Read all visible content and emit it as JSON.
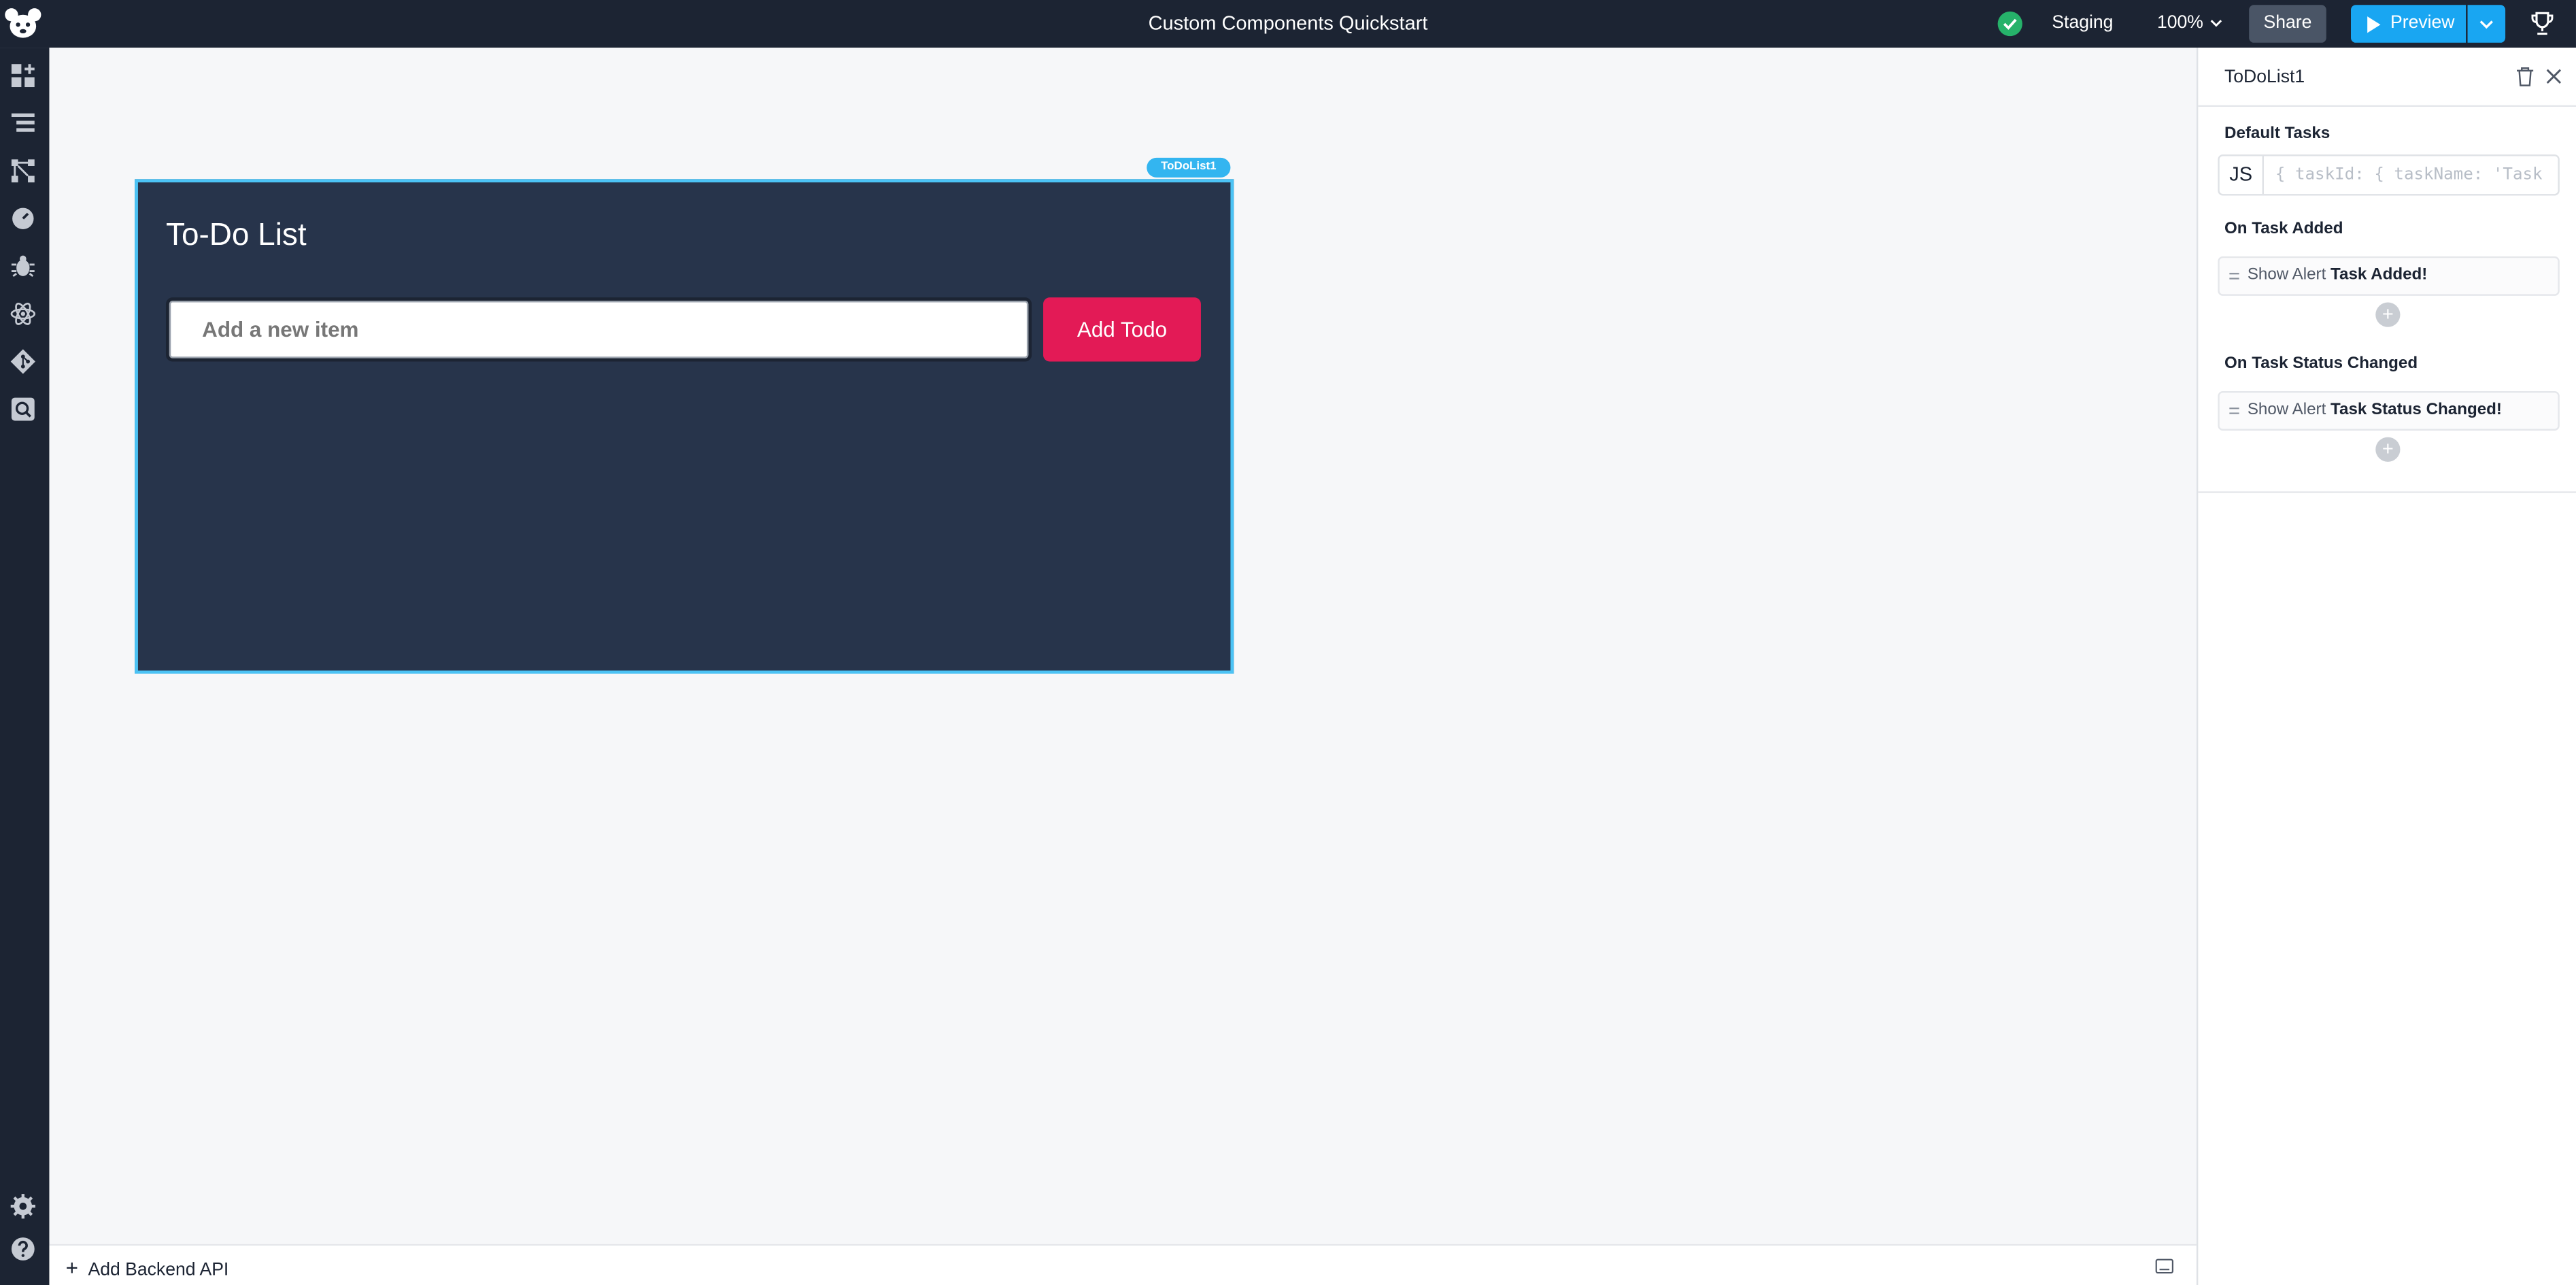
{
  "topbar": {
    "app_title": "Custom Components Quickstart",
    "environment": "Staging",
    "zoom": "100%",
    "share_label": "Share",
    "preview_label": "Preview"
  },
  "rail": {
    "icons": [
      "components-icon",
      "query-list-icon",
      "workflows-icon",
      "state-icon",
      "debug-icon",
      "react-icon",
      "git-icon",
      "search-icon"
    ],
    "bottom_icons": [
      "settings-icon",
      "help-icon"
    ]
  },
  "canvas": {
    "widget_tag": "ToDoList1",
    "todo_title": "To-Do List",
    "input_placeholder": "Add a new item",
    "add_button_label": "Add Todo"
  },
  "bottombar": {
    "add_api_label": "Add Backend API"
  },
  "panel": {
    "title": "ToDoList1",
    "default_tasks_label": "Default Tasks",
    "js_tag": "JS",
    "js_value": "{ taskId: { taskName: 'Task",
    "on_task_added_label": "On Task Added",
    "on_task_added_action_prefix": "Show Alert",
    "on_task_added_action_value": "Task Added!",
    "on_task_status_label": "On Task Status Changed",
    "on_task_status_action_prefix": "Show Alert",
    "on_task_status_action_value": "Task Status Changed!"
  },
  "colors": {
    "topbar_bg": "#1c2433",
    "accent_blue": "#19a6f2",
    "widget_bg": "#27344b",
    "add_todo_bg": "#e31a56",
    "status_green": "#26b26a"
  }
}
